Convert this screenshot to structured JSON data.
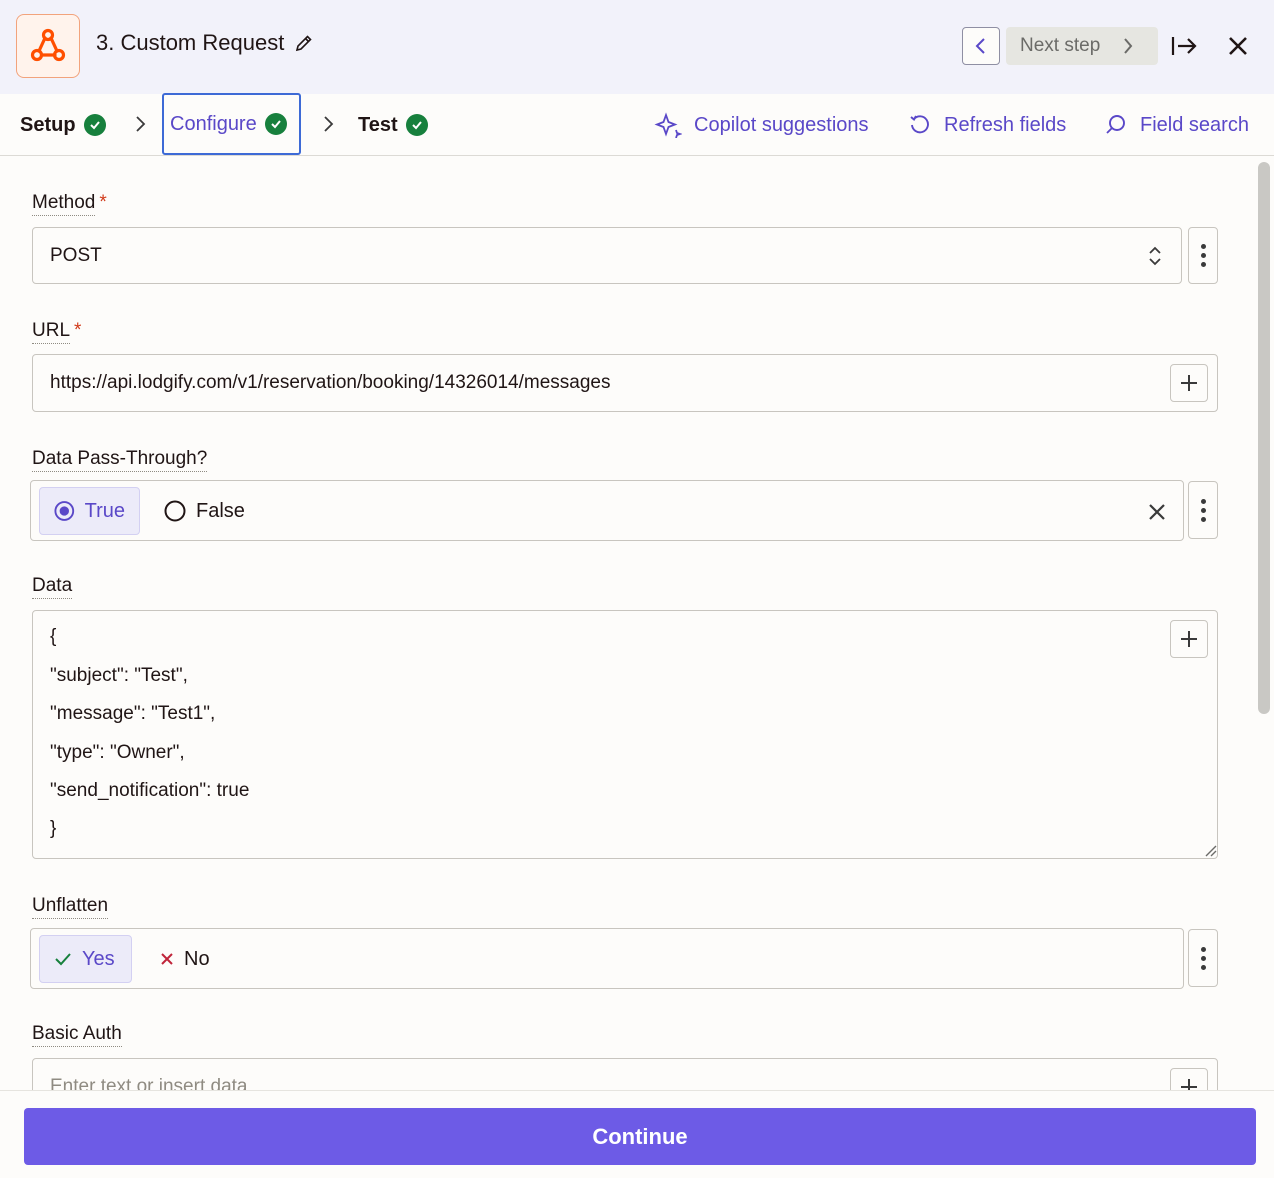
{
  "header": {
    "title": "3. Custom Request",
    "next_step_label": "Next step"
  },
  "tabs": {
    "setup": "Setup",
    "configure": "Configure",
    "test": "Test"
  },
  "actions": {
    "copilot": "Copilot suggestions",
    "refresh": "Refresh fields",
    "search": "Field search"
  },
  "form": {
    "method": {
      "label": "Method",
      "value": "POST"
    },
    "url": {
      "label": "URL",
      "value": "https://api.lodgify.com/v1/reservation/booking/14326014/messages"
    },
    "pass_through": {
      "label": "Data Pass-Through?",
      "true_label": "True",
      "false_label": "False",
      "selected": "True"
    },
    "data": {
      "label": "Data",
      "lines": [
        "{",
        "\"subject\": \"Test\",",
        "\"message\": \"Test1\",",
        "\"type\": \"Owner\",",
        "\"send_notification\": true",
        "}"
      ]
    },
    "unflatten": {
      "label": "Unflatten",
      "yes_label": "Yes",
      "no_label": "No",
      "selected": "Yes"
    },
    "basic_auth": {
      "label": "Basic Auth",
      "placeholder": "Enter text or insert data"
    }
  },
  "footer": {
    "continue_label": "Continue"
  },
  "colors": {
    "accent": "#6d5be6",
    "success": "#17803d",
    "link": "#5a48c8"
  }
}
